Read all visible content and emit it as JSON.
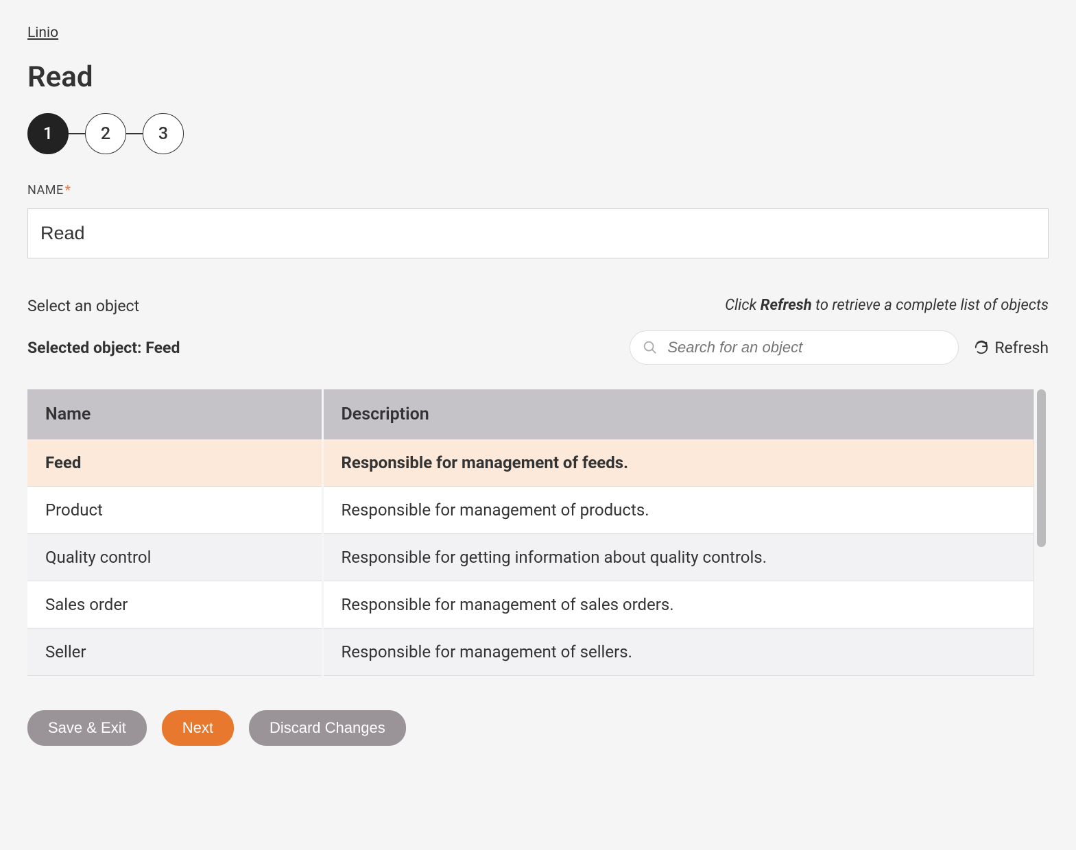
{
  "breadcrumb": {
    "label": "Linio"
  },
  "page_title": "Read",
  "stepper": {
    "steps": [
      "1",
      "2",
      "3"
    ],
    "active_index": 0
  },
  "name_field": {
    "label": "NAME",
    "required_mark": "*",
    "value": "Read"
  },
  "select_section": {
    "prompt": "Select an object",
    "helper_prefix": "Click ",
    "helper_bold": "Refresh",
    "helper_suffix": " to retrieve a complete list of objects",
    "selected_prefix": "Selected object: ",
    "selected_value": "Feed",
    "search_placeholder": "Search for an object",
    "refresh_label": "Refresh"
  },
  "table": {
    "columns": [
      "Name",
      "Description"
    ],
    "selected_row_index": 0,
    "rows": [
      {
        "name": "Feed",
        "description": "Responsible for management of feeds."
      },
      {
        "name": "Product",
        "description": "Responsible for management of products."
      },
      {
        "name": "Quality control",
        "description": "Responsible for getting information about quality controls."
      },
      {
        "name": "Sales order",
        "description": "Responsible for management of sales orders."
      },
      {
        "name": "Seller",
        "description": "Responsible for management of sellers."
      }
    ]
  },
  "buttons": {
    "save_exit": "Save & Exit",
    "next": "Next",
    "discard": "Discard Changes"
  }
}
